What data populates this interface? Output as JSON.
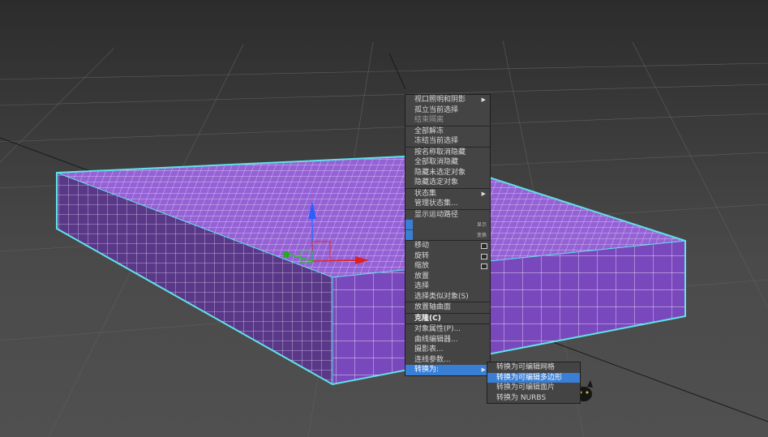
{
  "context_menu": {
    "items": [
      {
        "label": "视口照明和阴影",
        "arrow": true,
        "style": "normal"
      },
      {
        "label": "孤立当前选择",
        "style": "normal"
      },
      {
        "label": "结束隔离",
        "style": "dim"
      },
      {
        "sep": true
      },
      {
        "label": "全部解冻",
        "style": "normal"
      },
      {
        "label": "冻结当前选择",
        "style": "normal"
      },
      {
        "sep": true
      },
      {
        "label": "按名称取消隐藏",
        "style": "normal"
      },
      {
        "label": "全部取消隐藏",
        "style": "normal"
      },
      {
        "label": "隐藏未选定对象",
        "style": "normal"
      },
      {
        "label": "隐藏选定对象",
        "style": "normal"
      },
      {
        "sep": true
      },
      {
        "label": "状态集",
        "arrow": true,
        "style": "normal"
      },
      {
        "label": "管理状态集...",
        "style": "normal"
      },
      {
        "sep": true
      },
      {
        "label": "显示运动路径",
        "style": "normal"
      },
      {
        "quad": true,
        "label": "显示"
      },
      {
        "quad": true,
        "label": "变换"
      },
      {
        "sep": true
      },
      {
        "label": "移动",
        "box": true,
        "style": "normal"
      },
      {
        "label": "旋转",
        "box": true,
        "style": "normal"
      },
      {
        "label": "缩放",
        "box": true,
        "style": "normal"
      },
      {
        "label": "放置",
        "style": "normal"
      },
      {
        "label": "选择",
        "style": "normal"
      },
      {
        "label": "选择类似对象(S)",
        "style": "normal"
      },
      {
        "sep": true
      },
      {
        "label": "放置轴曲面",
        "style": "normal"
      },
      {
        "sep": true
      },
      {
        "label": "克隆(C)",
        "style": "bold"
      },
      {
        "sep": true
      },
      {
        "label": "对象属性(P)...",
        "style": "normal"
      },
      {
        "label": "曲线编辑器...",
        "style": "normal"
      },
      {
        "label": "摄影表...",
        "style": "normal"
      },
      {
        "label": "连线参数...",
        "style": "normal"
      },
      {
        "label": "转换为:",
        "arrow": true,
        "style": "hl"
      }
    ]
  },
  "convert_submenu": {
    "items": [
      {
        "label": "转换为可编辑网格",
        "highlighted": false
      },
      {
        "label": "转换为可编辑多边形",
        "highlighted": true
      },
      {
        "label": "转换为可编辑面片",
        "highlighted": false
      },
      {
        "label": "转换为 NURBS",
        "highlighted": false
      }
    ]
  },
  "colors": {
    "box_face": "#8e5bd0",
    "box_side": "#5b3a8a",
    "box_front": "#7845b8",
    "selection": "#5fe2ea",
    "menu_highlight": "#3a7fd6"
  }
}
